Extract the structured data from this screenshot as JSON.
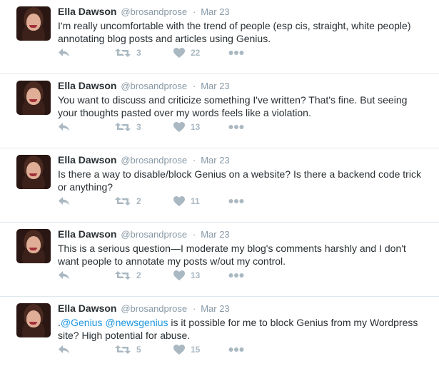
{
  "tweets": [
    {
      "name": "Ella Dawson",
      "handle": "@brosandprose",
      "dot": "·",
      "date": "Mar 23",
      "text": "I'm really uncomfortable with the trend of people (esp cis, straight, white people) annotating blog posts and articles using Genius.",
      "retweets": "3",
      "likes": "22"
    },
    {
      "name": "Ella Dawson",
      "handle": "@brosandprose",
      "dot": "·",
      "date": "Mar 23",
      "text": "You want to discuss and criticize something I've written? That's fine. But seeing your thoughts pasted over my words feels like a violation.",
      "retweets": "3",
      "likes": "13"
    },
    {
      "name": "Ella Dawson",
      "handle": "@brosandprose",
      "dot": "·",
      "date": "Mar 23",
      "text": "Is there a way to disable/block Genius on a website? Is there a backend code trick or anything?",
      "retweets": "2",
      "likes": "11"
    },
    {
      "name": "Ella Dawson",
      "handle": "@brosandprose",
      "dot": "·",
      "date": "Mar 23",
      "text": "This is a serious question—I moderate my blog's comments harshly and I don't want people to annotate my posts w/out my control.",
      "retweets": "2",
      "likes": "13"
    },
    {
      "name": "Ella Dawson",
      "handle": "@brosandprose",
      "dot": "·",
      "date": "Mar 23",
      "text_prefix": ".",
      "mention1": "@Genius",
      "mention2": "@newsgenius",
      "text_after": " is it possible for me to block Genius from my Wordpress site? High potential for abuse.",
      "retweets": "5",
      "likes": "15"
    }
  ],
  "icons": {
    "reply": "reply-icon",
    "retweet": "retweet-icon",
    "like": "heart-icon",
    "more": "more-icon"
  },
  "colors": {
    "name": "#292f33",
    "meta": "#8899a6",
    "link": "#1b95e0",
    "action": "#aab8c2",
    "divider": "#e1e8ed"
  }
}
